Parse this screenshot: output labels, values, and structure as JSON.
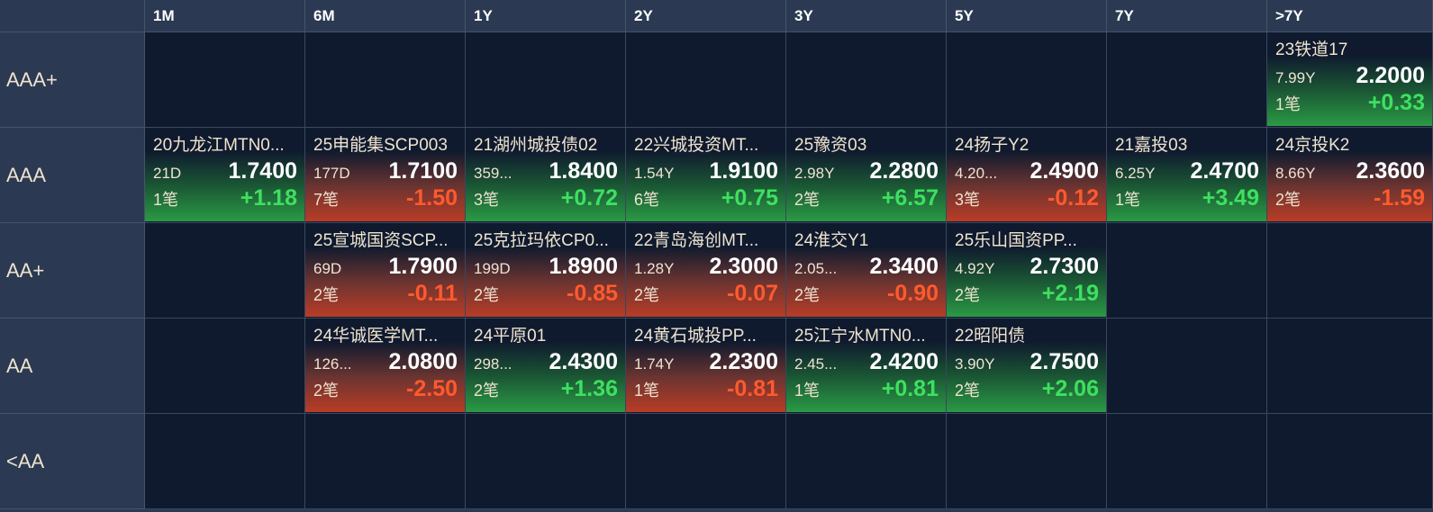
{
  "header": {
    "columns": [
      "1M",
      "6M",
      "1Y",
      "2Y",
      "3Y",
      "5Y",
      "7Y",
      ">7Y"
    ]
  },
  "rows": [
    "AAA+",
    "AAA",
    "AA+",
    "AA",
    "<AA"
  ],
  "colors": {
    "up": "#3ee060",
    "down": "#ff5a2e",
    "header_bg": "#2b3a52",
    "page_bg": "#0f1a2e"
  },
  "cards": [
    {
      "row": 0,
      "col": 7,
      "name": "23铁道17",
      "term": "7.99Y",
      "price": "2.2000",
      "count": "1笔",
      "change": "+0.33",
      "dir": "up"
    },
    {
      "row": 1,
      "col": 0,
      "name": "20九龙江MTN0...",
      "term": "21D",
      "price": "1.7400",
      "count": "1笔",
      "change": "+1.18",
      "dir": "up"
    },
    {
      "row": 1,
      "col": 1,
      "name": "25申能集SCP003",
      "term": "177D",
      "price": "1.7100",
      "count": "7笔",
      "change": "-1.50",
      "dir": "down"
    },
    {
      "row": 1,
      "col": 2,
      "name": "21湖州城投债02",
      "term": "359...",
      "price": "1.8400",
      "count": "3笔",
      "change": "+0.72",
      "dir": "up"
    },
    {
      "row": 1,
      "col": 3,
      "name": "22兴城投资MT...",
      "term": "1.54Y",
      "price": "1.9100",
      "count": "6笔",
      "change": "+0.75",
      "dir": "up"
    },
    {
      "row": 1,
      "col": 4,
      "name": "25豫资03",
      "term": "2.98Y",
      "price": "2.2800",
      "count": "2笔",
      "change": "+6.57",
      "dir": "up"
    },
    {
      "row": 1,
      "col": 5,
      "name": "24扬子Y2",
      "term": "4.20...",
      "price": "2.4900",
      "count": "3笔",
      "change": "-0.12",
      "dir": "down"
    },
    {
      "row": 1,
      "col": 6,
      "name": "21嘉投03",
      "term": "6.25Y",
      "price": "2.4700",
      "count": "1笔",
      "change": "+3.49",
      "dir": "up"
    },
    {
      "row": 1,
      "col": 7,
      "name": "24京投K2",
      "term": "8.66Y",
      "price": "2.3600",
      "count": "2笔",
      "change": "-1.59",
      "dir": "down"
    },
    {
      "row": 2,
      "col": 1,
      "name": "25宣城国资SCP...",
      "term": "69D",
      "price": "1.7900",
      "count": "2笔",
      "change": "-0.11",
      "dir": "down"
    },
    {
      "row": 2,
      "col": 2,
      "name": "25克拉玛依CP0...",
      "term": "199D",
      "price": "1.8900",
      "count": "2笔",
      "change": "-0.85",
      "dir": "down"
    },
    {
      "row": 2,
      "col": 3,
      "name": "22青岛海创MT...",
      "term": "1.28Y",
      "price": "2.3000",
      "count": "2笔",
      "change": "-0.07",
      "dir": "down"
    },
    {
      "row": 2,
      "col": 4,
      "name": "24淮交Y1",
      "term": "2.05...",
      "price": "2.3400",
      "count": "2笔",
      "change": "-0.90",
      "dir": "down"
    },
    {
      "row": 2,
      "col": 5,
      "name": "25乐山国资PP...",
      "term": "4.92Y",
      "price": "2.7300",
      "count": "2笔",
      "change": "+2.19",
      "dir": "up"
    },
    {
      "row": 3,
      "col": 1,
      "name": "24华诚医学MT...",
      "term": "126...",
      "price": "2.0800",
      "count": "2笔",
      "change": "-2.50",
      "dir": "down"
    },
    {
      "row": 3,
      "col": 2,
      "name": "24平原01",
      "term": "298...",
      "price": "2.4300",
      "count": "2笔",
      "change": "+1.36",
      "dir": "up"
    },
    {
      "row": 3,
      "col": 3,
      "name": "24黄石城投PP...",
      "term": "1.74Y",
      "price": "2.2300",
      "count": "1笔",
      "change": "-0.81",
      "dir": "down"
    },
    {
      "row": 3,
      "col": 4,
      "name": "25江宁水MTN0...",
      "term": "2.45...",
      "price": "2.4200",
      "count": "1笔",
      "change": "+0.81",
      "dir": "up"
    },
    {
      "row": 3,
      "col": 5,
      "name": "22昭阳债",
      "term": "3.90Y",
      "price": "2.7500",
      "count": "2笔",
      "change": "+2.06",
      "dir": "up"
    }
  ]
}
